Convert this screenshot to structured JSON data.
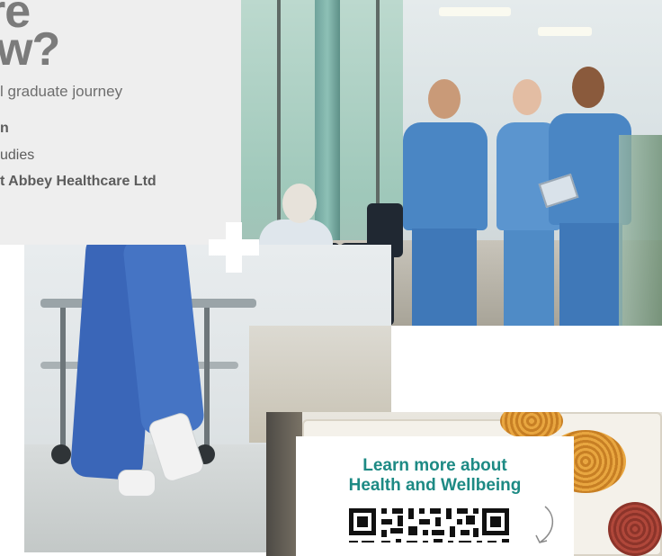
{
  "panel": {
    "headline_line1": "re",
    "headline_line2": "w?",
    "subhead": "l graduate journey",
    "name": "n",
    "course": "udies",
    "role": "t Abbey Healthcare Ltd"
  },
  "cta": {
    "title_line1": "Learn more about",
    "title_line2": "Health and Wellbeing"
  },
  "colors": {
    "panel_bg": "#eeeeee",
    "headline": "#7b7b7b",
    "accent_teal": "#1d8a84",
    "scrubs_blue": "#4a86c4"
  },
  "icons": {
    "plus": "plus-icon",
    "arrow": "curved-arrow-icon",
    "qr": "qr-code-icon"
  }
}
